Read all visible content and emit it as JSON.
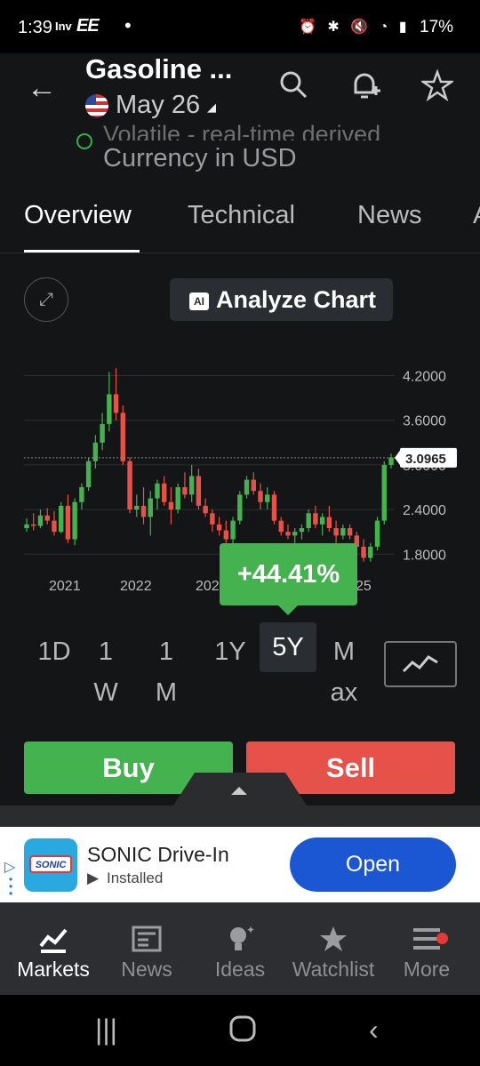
{
  "status": {
    "time": "1:39",
    "carrier_icon": "Inv",
    "ee": "EE",
    "battery": "17%"
  },
  "header": {
    "title": "Gasoline ...",
    "date": "May 26",
    "info_line": "Volatile - real-time derived",
    "currency": "Currency in USD"
  },
  "tabs": [
    "Overview",
    "Technical",
    "News"
  ],
  "chart_controls": {
    "analyze_label": "Analyze Chart",
    "ai_badge": "AI"
  },
  "chart_data": {
    "type": "candlestick",
    "x_tick_labels": [
      "2021",
      "2022",
      "202",
      "25"
    ],
    "y_tick_labels": [
      "4.2000",
      "3.6000",
      "3.0000",
      "2.4000",
      "1.8000"
    ],
    "ylim": [
      1.6,
      4.35
    ],
    "last_price": "3.0965",
    "change_label": "+44.41%",
    "candles": [
      {
        "o": 2.15,
        "h": 2.28,
        "l": 2.1,
        "c": 2.2
      },
      {
        "o": 2.2,
        "h": 2.35,
        "l": 2.12,
        "c": 2.18
      },
      {
        "o": 2.18,
        "h": 2.4,
        "l": 2.15,
        "c": 2.32
      },
      {
        "o": 2.32,
        "h": 2.42,
        "l": 2.2,
        "c": 2.25
      },
      {
        "o": 2.25,
        "h": 2.38,
        "l": 2.05,
        "c": 2.1
      },
      {
        "o": 2.1,
        "h": 2.5,
        "l": 2.08,
        "c": 2.45
      },
      {
        "o": 2.45,
        "h": 2.6,
        "l": 1.95,
        "c": 2.0
      },
      {
        "o": 2.0,
        "h": 2.55,
        "l": 1.92,
        "c": 2.5
      },
      {
        "o": 2.5,
        "h": 2.75,
        "l": 2.4,
        "c": 2.7
      },
      {
        "o": 2.7,
        "h": 3.1,
        "l": 2.65,
        "c": 3.05
      },
      {
        "o": 3.05,
        "h": 3.4,
        "l": 2.95,
        "c": 3.3
      },
      {
        "o": 3.3,
        "h": 3.7,
        "l": 3.2,
        "c": 3.55
      },
      {
        "o": 3.55,
        "h": 4.25,
        "l": 3.45,
        "c": 3.95
      },
      {
        "o": 3.95,
        "h": 4.3,
        "l": 3.6,
        "c": 3.7
      },
      {
        "o": 3.7,
        "h": 3.8,
        "l": 3.0,
        "c": 3.05
      },
      {
        "o": 3.05,
        "h": 3.1,
        "l": 2.35,
        "c": 2.4
      },
      {
        "o": 2.4,
        "h": 2.6,
        "l": 2.3,
        "c": 2.45
      },
      {
        "o": 2.45,
        "h": 2.7,
        "l": 2.2,
        "c": 2.3
      },
      {
        "o": 2.3,
        "h": 2.65,
        "l": 2.05,
        "c": 2.55
      },
      {
        "o": 2.55,
        "h": 2.8,
        "l": 2.4,
        "c": 2.75
      },
      {
        "o": 2.75,
        "h": 2.85,
        "l": 2.45,
        "c": 2.5
      },
      {
        "o": 2.5,
        "h": 2.7,
        "l": 2.2,
        "c": 2.4
      },
      {
        "o": 2.4,
        "h": 2.75,
        "l": 2.35,
        "c": 2.7
      },
      {
        "o": 2.7,
        "h": 2.9,
        "l": 2.55,
        "c": 2.6
      },
      {
        "o": 2.6,
        "h": 3.0,
        "l": 2.5,
        "c": 2.85
      },
      {
        "o": 2.85,
        "h": 2.95,
        "l": 2.4,
        "c": 2.45
      },
      {
        "o": 2.45,
        "h": 2.55,
        "l": 2.3,
        "c": 2.35
      },
      {
        "o": 2.35,
        "h": 2.4,
        "l": 2.1,
        "c": 2.2
      },
      {
        "o": 2.2,
        "h": 2.3,
        "l": 2.05,
        "c": 2.12
      },
      {
        "o": 2.12,
        "h": 2.25,
        "l": 1.95,
        "c": 2.0
      },
      {
        "o": 2.0,
        "h": 2.3,
        "l": 1.9,
        "c": 2.25
      },
      {
        "o": 2.25,
        "h": 2.65,
        "l": 2.2,
        "c": 2.6
      },
      {
        "o": 2.6,
        "h": 2.85,
        "l": 2.55,
        "c": 2.8
      },
      {
        "o": 2.8,
        "h": 2.9,
        "l": 2.6,
        "c": 2.65
      },
      {
        "o": 2.65,
        "h": 2.75,
        "l": 2.4,
        "c": 2.5
      },
      {
        "o": 2.5,
        "h": 2.7,
        "l": 2.4,
        "c": 2.6
      },
      {
        "o": 2.6,
        "h": 2.65,
        "l": 2.2,
        "c": 2.25
      },
      {
        "o": 2.25,
        "h": 2.3,
        "l": 2.05,
        "c": 2.1
      },
      {
        "o": 2.1,
        "h": 2.2,
        "l": 2.0,
        "c": 2.05
      },
      {
        "o": 2.05,
        "h": 2.15,
        "l": 1.95,
        "c": 2.1
      },
      {
        "o": 2.1,
        "h": 2.2,
        "l": 2.0,
        "c": 2.15
      },
      {
        "o": 2.15,
        "h": 2.4,
        "l": 2.1,
        "c": 2.35
      },
      {
        "o": 2.35,
        "h": 2.45,
        "l": 2.15,
        "c": 2.2
      },
      {
        "o": 2.2,
        "h": 2.35,
        "l": 2.05,
        "c": 2.3
      },
      {
        "o": 2.3,
        "h": 2.45,
        "l": 2.1,
        "c": 2.15
      },
      {
        "o": 2.15,
        "h": 2.25,
        "l": 1.95,
        "c": 2.05
      },
      {
        "o": 2.05,
        "h": 2.2,
        "l": 2.0,
        "c": 2.15
      },
      {
        "o": 2.15,
        "h": 2.2,
        "l": 2.0,
        "c": 2.05
      },
      {
        "o": 2.05,
        "h": 2.1,
        "l": 1.85,
        "c": 1.9
      },
      {
        "o": 1.9,
        "h": 2.0,
        "l": 1.7,
        "c": 1.75
      },
      {
        "o": 1.75,
        "h": 1.95,
        "l": 1.7,
        "c": 1.9
      },
      {
        "o": 1.9,
        "h": 2.3,
        "l": 1.85,
        "c": 2.25
      },
      {
        "o": 2.25,
        "h": 3.05,
        "l": 2.2,
        "c": 3.0
      },
      {
        "o": 3.0,
        "h": 3.15,
        "l": 2.95,
        "c": 3.1
      }
    ]
  },
  "ranges": [
    {
      "label": "1D"
    },
    {
      "label": "1\nW"
    },
    {
      "label": "1\nM"
    },
    {
      "label": "1Y"
    },
    {
      "label": "5Y",
      "active": true
    },
    {
      "label": "M\nax"
    }
  ],
  "actions": {
    "buy": "Buy",
    "sell": "Sell"
  },
  "ad": {
    "logo_text": "SONIC",
    "title": "SONIC Drive-In",
    "subtitle": "Installed",
    "cta": "Open"
  },
  "bottom_nav": [
    {
      "label": "Markets",
      "icon": "markets-icon",
      "active": true
    },
    {
      "label": "News",
      "icon": "news-icon"
    },
    {
      "label": "Ideas",
      "icon": "ideas-icon"
    },
    {
      "label": "Watchlist",
      "icon": "watchlist-icon"
    },
    {
      "label": "More",
      "icon": "more-icon"
    }
  ],
  "colors": {
    "up": "#44b24f",
    "down": "#e65149",
    "background": "#141516"
  }
}
